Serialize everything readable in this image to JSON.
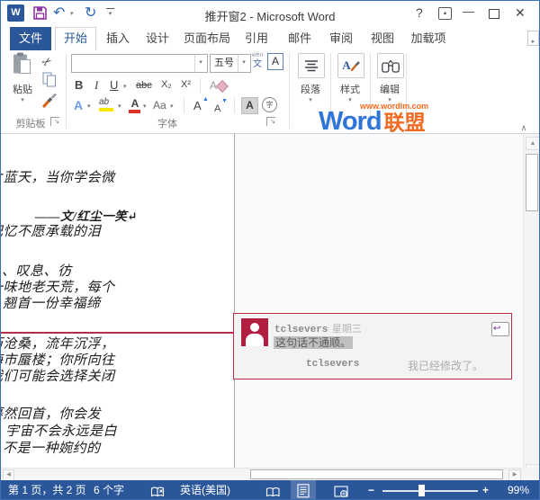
{
  "titlebar": {
    "title": "推开窗2 - Microsoft Word",
    "help": "?"
  },
  "tabs": {
    "file": "文件",
    "home": "开始",
    "insert": "插入",
    "design": "设计",
    "layout": "页面布局",
    "references": "引用",
    "mailings": "邮件",
    "review": "审阅",
    "view": "视图",
    "addins": "加载项"
  },
  "ribbon": {
    "paste": "粘贴",
    "clipboard_group": "剪贴板",
    "font_group": "字体",
    "font_size": "五号",
    "paragraph_group": "段落",
    "styles_group": "样式",
    "editing_group": "编辑",
    "buttons": {
      "bold": "B",
      "italic": "I",
      "underline": "U",
      "strikethrough": "abc",
      "subscript": "X₂",
      "superscript": "X²",
      "phonetic_top": "wén",
      "phonetic_bottom": "文",
      "char_border": "A",
      "text_effects": "A",
      "highlight": "ab",
      "font_color": "A",
      "change_case": "Aa",
      "grow_font": "A",
      "shrink_font": "A",
      "char_shading": "A",
      "enclose_char": "字",
      "styles_letter": "A"
    },
    "watermark": {
      "url": "www.wordlm.com",
      "word": "Word",
      "lm": "联盟"
    }
  },
  "doc": {
    "lines": [
      {
        "text": "片蓝天，当你学会微"
      },
      {
        "text": "——文/红尘一笑↵"
      },
      {
        "text": "记忆不愿承载的泪"
      },
      {
        "text": "、叹息、彷"
      },
      {
        "text": "一味地老天荒，每个"
      },
      {
        "text": "翘首一份幸福缔"
      },
      {
        "text": "历沧桑，流年沉浮，"
      },
      {
        "text": "海市蜃楼；你所向往"
      },
      {
        "text": "我们可能会选择关闭"
      },
      {
        "text": "蓦然回首，你会发"
      },
      {
        "text": "宇宙不会永远是白"
      },
      {
        "text": "不是一种婉约的"
      }
    ]
  },
  "comment": {
    "author": "tclsevers",
    "date": "星期三",
    "text": "这句话不通顺。",
    "reply_author": "tclsevers",
    "reply_text": "我已经修改了。"
  },
  "statusbar": {
    "page_info": "第 1 页，共 2 页",
    "word_count": "6 个字",
    "language": "英语(美国)",
    "zoom_level": "99%"
  },
  "colors": {
    "accent": "#2b579a",
    "comment_red": "#b82e46",
    "watermark_blue": "#2f76d8",
    "watermark_orange": "#f26a21",
    "highlight_yellow": "#f6e500",
    "font_color_red": "#dd3226"
  }
}
